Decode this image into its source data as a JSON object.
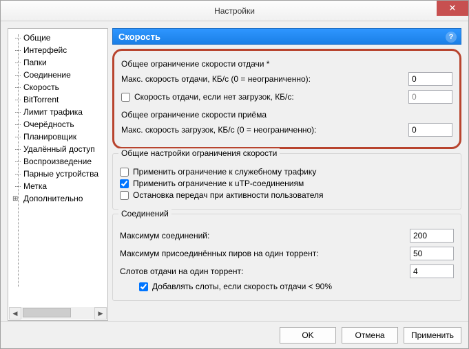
{
  "window": {
    "title": "Настройки"
  },
  "sidebar": {
    "items": [
      "Общие",
      "Интерфейс",
      "Папки",
      "Соединение",
      "Скорость",
      "BitTorrent",
      "Лимит трафика",
      "Очерёдность",
      "Планировщик",
      "Удалённый доступ",
      "Воспроизведение",
      "Парные устройства",
      "Метка"
    ],
    "advanced": "Дополнительно"
  },
  "header": {
    "title": "Скорость"
  },
  "upload": {
    "legend": "Общее ограничение скорости отдачи *",
    "max_label": "Макс. скорость отдачи, КБ/с (0 = неограниченно):",
    "max_value": "0",
    "alt_check_label": "Скорость отдачи, если нет загрузок, КБ/с:",
    "alt_checked": false,
    "alt_value": "0"
  },
  "download": {
    "legend": "Общее ограничение скорости приёма",
    "max_label": "Макс. скорость загрузок, КБ/с (0 = неограниченно):",
    "max_value": "0"
  },
  "general": {
    "legend": "Общие настройки ограничения скорости",
    "apply_overhead_label": "Применить ограничение к служебному трафику",
    "apply_overhead_checked": false,
    "apply_utp_label": "Применить ограничение к uTP-соединениям",
    "apply_utp_checked": true,
    "stop_on_activity_label": "Остановка передач при активности пользователя",
    "stop_on_activity_checked": false
  },
  "connections": {
    "legend": "Соединений",
    "max_conn_label": "Максимум соединений:",
    "max_conn_value": "200",
    "max_peers_label": "Максимум присоединённых пиров на один торрент:",
    "max_peers_value": "50",
    "slots_label": "Слотов отдачи на один торрент:",
    "slots_value": "4",
    "extra_slots_label": "Добавлять слоты, если скорость отдачи < 90%",
    "extra_slots_checked": true
  },
  "footer": {
    "ok": "OK",
    "cancel": "Отмена",
    "apply": "Применить"
  }
}
